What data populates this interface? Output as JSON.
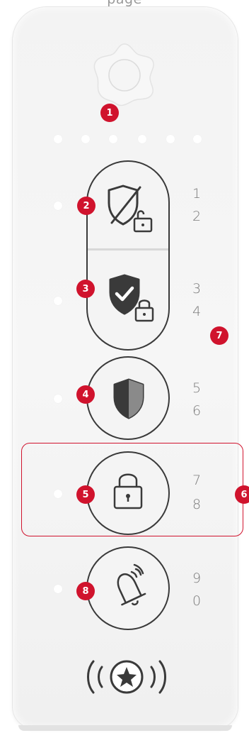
{
  "header": {
    "label": "page"
  },
  "keys": {
    "row1": [
      "1",
      "2"
    ],
    "row2": [
      "3",
      "4"
    ],
    "row3": [
      "5",
      "6"
    ],
    "row4": [
      "7",
      "8"
    ],
    "row5": [
      "9",
      "0"
    ]
  },
  "callouts": [
    "1",
    "2",
    "3",
    "4",
    "5",
    "6",
    "7",
    "8"
  ],
  "icons": {
    "sensor": "flower-sensor-icon",
    "disarm": "shield-slash-unlock-icon",
    "arm": "shield-check-lock-icon",
    "partial_arm": "half-shield-icon",
    "lock": "padlock-icon",
    "panic": "bell-icon",
    "alarm": "star-alarm-icon"
  },
  "colors": {
    "accent": "#d0132d",
    "icon_dark": "#3a3a3a",
    "device_bg": "#f4f4f4"
  }
}
